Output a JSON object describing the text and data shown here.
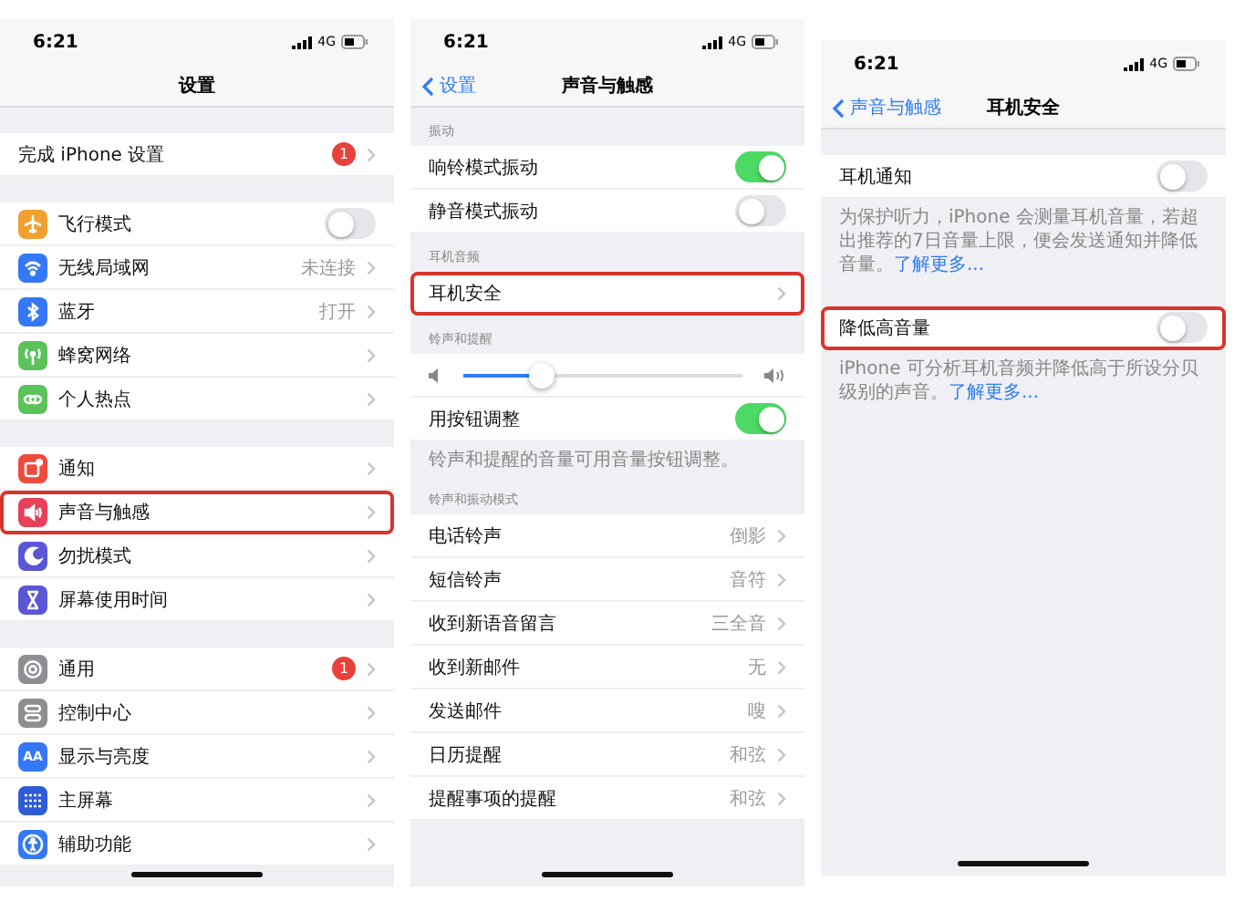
{
  "panels": [
    {
      "status_bar": {
        "time": "6:21",
        "network": "4G"
      },
      "nav": {
        "title": "设置"
      },
      "groups": [
        {
          "rows": [
            {
              "kind": "link",
              "label": "完成 iPhone 设置",
              "badge": "1",
              "highlighted": false
            }
          ]
        },
        {
          "rows": [
            {
              "kind": "toggle",
              "label": "飞行模式",
              "color": "#f0a030",
              "on": false,
              "highlighted": false
            },
            {
              "kind": "link",
              "label": "无线局域网",
              "value": "未连接",
              "color": "#3478f6",
              "highlighted": false
            },
            {
              "kind": "link",
              "label": "蓝牙",
              "value": "打开",
              "color": "#3478f6",
              "highlighted": false
            },
            {
              "kind": "link",
              "label": "蜂窝网络",
              "color": "#5cc25a",
              "highlighted": false
            },
            {
              "kind": "link",
              "label": "个人热点",
              "color": "#5cc25a",
              "highlighted": false
            }
          ]
        },
        {
          "rows": [
            {
              "kind": "link",
              "label": "通知",
              "color": "#ee4a3e",
              "highlighted": false
            },
            {
              "kind": "link",
              "label": "声音与触感",
              "color": "#e8405a",
              "highlighted": true
            },
            {
              "kind": "link",
              "label": "勿扰模式",
              "color": "#5b56d6",
              "highlighted": false
            },
            {
              "kind": "link",
              "label": "屏幕使用时间",
              "color": "#5b56d6",
              "highlighted": false
            }
          ]
        },
        {
          "rows": [
            {
              "kind": "link",
              "label": "通用",
              "badge": "1",
              "color": "#8e8e93",
              "highlighted": false
            },
            {
              "kind": "link",
              "label": "控制中心",
              "color": "#8e8e93",
              "highlighted": false
            },
            {
              "kind": "link",
              "label": "显示与亮度",
              "color": "#3478f6",
              "icon_text": "AA",
              "highlighted": false
            },
            {
              "kind": "link",
              "label": "主屏幕",
              "color": "#2f5bd8",
              "highlighted": false
            },
            {
              "kind": "link",
              "label": "辅助功能",
              "color": "#3478f6",
              "highlighted": false
            }
          ]
        }
      ]
    },
    {
      "status_bar": {
        "time": "6:21",
        "network": "4G"
      },
      "nav": {
        "back": "设置",
        "title": "声音与触感"
      },
      "groups": [
        {
          "header": "振动",
          "rows": [
            {
              "kind": "toggle",
              "label": "响铃模式振动",
              "on": true,
              "highlighted": false
            },
            {
              "kind": "toggle",
              "label": "静音模式振动",
              "on": false,
              "highlighted": false
            }
          ]
        },
        {
          "header": "耳机音频",
          "rows": [
            {
              "kind": "link",
              "label": "耳机安全",
              "highlighted": true
            }
          ]
        },
        {
          "header": "铃声和提醒",
          "rows": [
            {
              "kind": "slider",
              "level": 0.28,
              "highlighted": false
            },
            {
              "kind": "toggle",
              "label": "用按钮调整",
              "on": true,
              "highlighted": false
            }
          ],
          "footer": {
            "text": "铃声和提醒的音量可用音量按钮调整。"
          }
        },
        {
          "header": "铃声和振动模式",
          "rows": [
            {
              "kind": "link",
              "label": "电话铃声",
              "value": "倒影",
              "highlighted": false
            },
            {
              "kind": "link",
              "label": "短信铃声",
              "value": "音符",
              "highlighted": false
            },
            {
              "kind": "link",
              "label": "收到新语音留言",
              "value": "三全音",
              "highlighted": false
            },
            {
              "kind": "link",
              "label": "收到新邮件",
              "value": "无",
              "highlighted": false
            },
            {
              "kind": "link",
              "label": "发送邮件",
              "value": "嗖",
              "highlighted": false
            },
            {
              "kind": "link",
              "label": "日历提醒",
              "value": "和弦",
              "highlighted": false
            },
            {
              "kind": "link",
              "label": "提醒事项的提醒",
              "value": "和弦",
              "highlighted": false
            }
          ]
        }
      ]
    },
    {
      "status_bar": {
        "time": "6:21",
        "network": "4G"
      },
      "nav": {
        "back": "声音与触感",
        "title": "耳机安全"
      },
      "groups": [
        {
          "rows": [
            {
              "kind": "toggle",
              "label": "耳机通知",
              "on": false,
              "highlighted": false
            }
          ],
          "footer": {
            "text": "为保护听力，iPhone 会测量耳机音量，若超出推荐的7日音量上限，便会发送通知并降低音量。",
            "link": "了解更多..."
          }
        },
        {
          "rows": [
            {
              "kind": "toggle",
              "label": "降低高音量",
              "on": false,
              "highlighted": true
            }
          ],
          "footer": {
            "text": "iPhone 可分析耳机音频并降低高于所设分贝级别的声音。",
            "link": "了解更多..."
          }
        }
      ]
    }
  ]
}
